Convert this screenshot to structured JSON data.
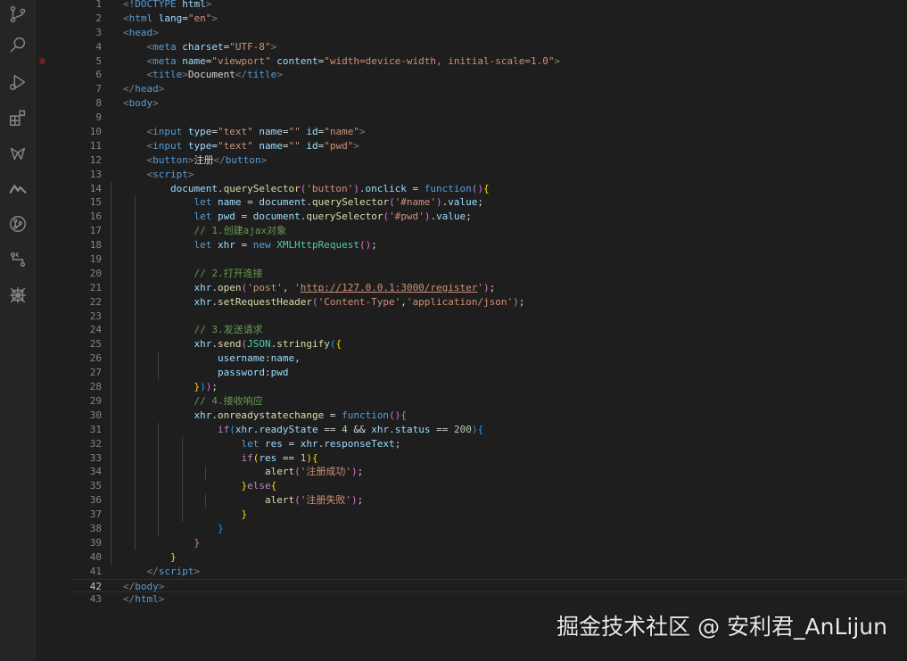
{
  "activity_bar": {
    "icons": [
      "source-control-icon",
      "search-icon",
      "run-debug-icon",
      "extensions-icon",
      "live-share-icon",
      "remote-icon",
      "git-graph-icon",
      "timeline-icon",
      "bug-pattern-icon"
    ]
  },
  "watermark": "掘金技术社区 @ 安利君_AnLijun",
  "editor": {
    "active_line": 42,
    "breakpoint_line": 5,
    "lines": [
      [
        [
          "t-punct",
          "<"
        ],
        [
          "t-tag",
          "!DOCTYPE"
        ],
        [
          "t-text",
          " "
        ],
        [
          "t-attr",
          "html"
        ],
        [
          "t-punct",
          ">"
        ]
      ],
      [
        [
          "t-punct",
          "<"
        ],
        [
          "t-tag",
          "html"
        ],
        [
          "t-text",
          " "
        ],
        [
          "t-attr",
          "lang"
        ],
        [
          "t-text",
          "="
        ],
        [
          "t-str",
          "\"en\""
        ],
        [
          "t-punct",
          ">"
        ]
      ],
      [
        [
          "t-punct",
          "<"
        ],
        [
          "t-tag",
          "head"
        ],
        [
          "t-punct",
          ">"
        ]
      ],
      [
        [
          "t-text",
          "    "
        ],
        [
          "t-punct",
          "<"
        ],
        [
          "t-tag",
          "meta"
        ],
        [
          "t-text",
          " "
        ],
        [
          "t-attr",
          "charset"
        ],
        [
          "t-text",
          "="
        ],
        [
          "t-str",
          "\"UTF-8\""
        ],
        [
          "t-punct",
          ">"
        ]
      ],
      [
        [
          "t-text",
          "    "
        ],
        [
          "t-punct",
          "<"
        ],
        [
          "t-tag",
          "meta"
        ],
        [
          "t-text",
          " "
        ],
        [
          "t-attr",
          "name"
        ],
        [
          "t-text",
          "="
        ],
        [
          "t-str",
          "\"viewport\""
        ],
        [
          "t-text",
          " "
        ],
        [
          "t-attr",
          "content"
        ],
        [
          "t-text",
          "="
        ],
        [
          "t-str",
          "\"width=device-width, initial-scale=1.0\""
        ],
        [
          "t-punct",
          ">"
        ]
      ],
      [
        [
          "t-text",
          "    "
        ],
        [
          "t-punct",
          "<"
        ],
        [
          "t-tag",
          "title"
        ],
        [
          "t-punct",
          ">"
        ],
        [
          "t-text",
          "Document"
        ],
        [
          "t-punct",
          "</"
        ],
        [
          "t-tag",
          "title"
        ],
        [
          "t-punct",
          ">"
        ]
      ],
      [
        [
          "t-punct",
          "</"
        ],
        [
          "t-tag",
          "head"
        ],
        [
          "t-punct",
          ">"
        ]
      ],
      [
        [
          "t-punct",
          "<"
        ],
        [
          "t-tag",
          "body"
        ],
        [
          "t-punct",
          ">"
        ]
      ],
      [],
      [
        [
          "t-text",
          "    "
        ],
        [
          "t-punct",
          "<"
        ],
        [
          "t-tag",
          "input"
        ],
        [
          "t-text",
          " "
        ],
        [
          "t-attr",
          "type"
        ],
        [
          "t-text",
          "="
        ],
        [
          "t-str",
          "\"text\""
        ],
        [
          "t-text",
          " "
        ],
        [
          "t-attr",
          "name"
        ],
        [
          "t-text",
          "="
        ],
        [
          "t-str",
          "\"\""
        ],
        [
          "t-text",
          " "
        ],
        [
          "t-attr",
          "id"
        ],
        [
          "t-text",
          "="
        ],
        [
          "t-str",
          "\"name\""
        ],
        [
          "t-punct",
          ">"
        ]
      ],
      [
        [
          "t-text",
          "    "
        ],
        [
          "t-punct",
          "<"
        ],
        [
          "t-tag",
          "input"
        ],
        [
          "t-text",
          " "
        ],
        [
          "t-attr",
          "type"
        ],
        [
          "t-text",
          "="
        ],
        [
          "t-str",
          "\"text\""
        ],
        [
          "t-text",
          " "
        ],
        [
          "t-attr",
          "name"
        ],
        [
          "t-text",
          "="
        ],
        [
          "t-str",
          "\"\""
        ],
        [
          "t-text",
          " "
        ],
        [
          "t-attr",
          "id"
        ],
        [
          "t-text",
          "="
        ],
        [
          "t-str",
          "\"pwd\""
        ],
        [
          "t-punct",
          ">"
        ]
      ],
      [
        [
          "t-text",
          "    "
        ],
        [
          "t-punct",
          "<"
        ],
        [
          "t-tag",
          "button"
        ],
        [
          "t-punct",
          ">"
        ],
        [
          "t-text",
          "注册"
        ],
        [
          "t-punct",
          "</"
        ],
        [
          "t-tag",
          "button"
        ],
        [
          "t-punct",
          ">"
        ]
      ],
      [
        [
          "t-text",
          "    "
        ],
        [
          "t-punct",
          "<"
        ],
        [
          "t-tag",
          "script"
        ],
        [
          "t-punct",
          ">"
        ]
      ],
      [
        [
          "t-text",
          "        "
        ],
        [
          "t-var",
          "document"
        ],
        [
          "t-text",
          "."
        ],
        [
          "t-fn",
          "querySelector"
        ],
        [
          "t-b2",
          "("
        ],
        [
          "t-str",
          "'button'"
        ],
        [
          "t-b2",
          ")"
        ],
        [
          "t-text",
          "."
        ],
        [
          "t-var",
          "onclick"
        ],
        [
          "t-text",
          " = "
        ],
        [
          "t-kw",
          "function"
        ],
        [
          "t-b2",
          "()"
        ],
        [
          "t-b1",
          "{"
        ]
      ],
      [
        [
          "t-text",
          "            "
        ],
        [
          "t-kw",
          "let"
        ],
        [
          "t-text",
          " "
        ],
        [
          "t-var",
          "name"
        ],
        [
          "t-text",
          " = "
        ],
        [
          "t-var",
          "document"
        ],
        [
          "t-text",
          "."
        ],
        [
          "t-fn",
          "querySelector"
        ],
        [
          "t-b2",
          "("
        ],
        [
          "t-str",
          "'#name'"
        ],
        [
          "t-b2",
          ")"
        ],
        [
          "t-text",
          "."
        ],
        [
          "t-var",
          "value"
        ],
        [
          "t-text",
          ";"
        ]
      ],
      [
        [
          "t-text",
          "            "
        ],
        [
          "t-kw",
          "let"
        ],
        [
          "t-text",
          " "
        ],
        [
          "t-var",
          "pwd"
        ],
        [
          "t-text",
          " = "
        ],
        [
          "t-var",
          "document"
        ],
        [
          "t-text",
          "."
        ],
        [
          "t-fn",
          "querySelector"
        ],
        [
          "t-b2",
          "("
        ],
        [
          "t-str",
          "'#pwd'"
        ],
        [
          "t-b2",
          ")"
        ],
        [
          "t-text",
          "."
        ],
        [
          "t-var",
          "value"
        ],
        [
          "t-text",
          ";"
        ]
      ],
      [
        [
          "t-text",
          "            "
        ],
        [
          "t-cmt",
          "// 1.创建ajax对象"
        ]
      ],
      [
        [
          "t-text",
          "            "
        ],
        [
          "t-kw",
          "let"
        ],
        [
          "t-text",
          " "
        ],
        [
          "t-var",
          "xhr"
        ],
        [
          "t-text",
          " = "
        ],
        [
          "t-kw",
          "new"
        ],
        [
          "t-text",
          " "
        ],
        [
          "t-cls",
          "XMLHttpRequest"
        ],
        [
          "t-b2",
          "()"
        ],
        [
          "t-text",
          ";"
        ]
      ],
      [],
      [
        [
          "t-text",
          "            "
        ],
        [
          "t-cmt",
          "// 2.打开连接"
        ]
      ],
      [
        [
          "t-text",
          "            "
        ],
        [
          "t-var",
          "xhr"
        ],
        [
          "t-text",
          "."
        ],
        [
          "t-fn",
          "open"
        ],
        [
          "t-b2",
          "("
        ],
        [
          "t-str",
          "'post'"
        ],
        [
          "t-text",
          ", "
        ],
        [
          "t-str",
          "'"
        ],
        [
          "t-url",
          "http://127.0.0.1:3000/register"
        ],
        [
          "t-str",
          "'"
        ],
        [
          "t-b2",
          ")"
        ],
        [
          "t-text",
          ";"
        ]
      ],
      [
        [
          "t-text",
          "            "
        ],
        [
          "t-var",
          "xhr"
        ],
        [
          "t-text",
          "."
        ],
        [
          "t-fn",
          "setRequestHeader"
        ],
        [
          "t-b2",
          "("
        ],
        [
          "t-str",
          "'Content-Type'"
        ],
        [
          "t-text",
          ","
        ],
        [
          "t-str",
          "'application/json'"
        ],
        [
          "t-b2",
          ")"
        ],
        [
          "t-text",
          ";"
        ]
      ],
      [],
      [
        [
          "t-text",
          "            "
        ],
        [
          "t-cmt",
          "// 3.发送请求"
        ]
      ],
      [
        [
          "t-text",
          "            "
        ],
        [
          "t-var",
          "xhr"
        ],
        [
          "t-text",
          "."
        ],
        [
          "t-fn",
          "send"
        ],
        [
          "t-b2",
          "("
        ],
        [
          "t-cls",
          "JSON"
        ],
        [
          "t-text",
          "."
        ],
        [
          "t-fn",
          "stringify"
        ],
        [
          "t-b3",
          "("
        ],
        [
          "t-b1",
          "{"
        ]
      ],
      [
        [
          "t-text",
          "                "
        ],
        [
          "t-var",
          "username"
        ],
        [
          "t-text",
          ":"
        ],
        [
          "t-var",
          "name"
        ],
        [
          "t-text",
          ","
        ]
      ],
      [
        [
          "t-text",
          "                "
        ],
        [
          "t-var",
          "password"
        ],
        [
          "t-text",
          ":"
        ],
        [
          "t-var",
          "pwd"
        ]
      ],
      [
        [
          "t-text",
          "            "
        ],
        [
          "t-b1",
          "}"
        ],
        [
          "t-b3",
          ")"
        ],
        [
          "t-b2",
          ")"
        ],
        [
          "t-text",
          ";"
        ]
      ],
      [
        [
          "t-text",
          "            "
        ],
        [
          "t-cmt",
          "// 4.接收响应"
        ]
      ],
      [
        [
          "t-text",
          "            "
        ],
        [
          "t-var",
          "xhr"
        ],
        [
          "t-text",
          "."
        ],
        [
          "t-fn",
          "onreadystatechange"
        ],
        [
          "t-text",
          " = "
        ],
        [
          "t-kw",
          "function"
        ],
        [
          "t-b2",
          "()"
        ],
        [
          "t-b2",
          "{"
        ]
      ],
      [
        [
          "t-text",
          "                "
        ],
        [
          "t-ctrl",
          "if"
        ],
        [
          "t-b3",
          "("
        ],
        [
          "t-var",
          "xhr"
        ],
        [
          "t-text",
          "."
        ],
        [
          "t-var",
          "readyState"
        ],
        [
          "t-text",
          " == "
        ],
        [
          "t-num",
          "4"
        ],
        [
          "t-text",
          " && "
        ],
        [
          "t-var",
          "xhr"
        ],
        [
          "t-text",
          "."
        ],
        [
          "t-var",
          "status"
        ],
        [
          "t-text",
          " == "
        ],
        [
          "t-num",
          "200"
        ],
        [
          "t-b3",
          ")"
        ],
        [
          "t-b3",
          "{"
        ]
      ],
      [
        [
          "t-text",
          "                    "
        ],
        [
          "t-kw",
          "let"
        ],
        [
          "t-text",
          " "
        ],
        [
          "t-var",
          "res"
        ],
        [
          "t-text",
          " = "
        ],
        [
          "t-var",
          "xhr"
        ],
        [
          "t-text",
          "."
        ],
        [
          "t-var",
          "responseText"
        ],
        [
          "t-text",
          ";"
        ]
      ],
      [
        [
          "t-text",
          "                    "
        ],
        [
          "t-ctrl",
          "if"
        ],
        [
          "t-b1",
          "("
        ],
        [
          "t-var",
          "res"
        ],
        [
          "t-text",
          " == "
        ],
        [
          "t-num",
          "1"
        ],
        [
          "t-b1",
          ")"
        ],
        [
          "t-b1",
          "{"
        ]
      ],
      [
        [
          "t-text",
          "                        "
        ],
        [
          "t-fn",
          "alert"
        ],
        [
          "t-b2",
          "("
        ],
        [
          "t-str",
          "'注册成功'"
        ],
        [
          "t-b2",
          ")"
        ],
        [
          "t-text",
          ";"
        ]
      ],
      [
        [
          "t-text",
          "                    "
        ],
        [
          "t-b1",
          "}"
        ],
        [
          "t-ctrl",
          "else"
        ],
        [
          "t-b1",
          "{"
        ]
      ],
      [
        [
          "t-text",
          "                        "
        ],
        [
          "t-fn",
          "alert"
        ],
        [
          "t-b2",
          "("
        ],
        [
          "t-str",
          "'注册失败'"
        ],
        [
          "t-b2",
          ")"
        ],
        [
          "t-text",
          ";"
        ]
      ],
      [
        [
          "t-text",
          "                    "
        ],
        [
          "t-b1",
          "}"
        ]
      ],
      [
        [
          "t-text",
          "                "
        ],
        [
          "t-b3",
          "}"
        ]
      ],
      [
        [
          "t-text",
          "            "
        ],
        [
          "t-b2",
          "}"
        ]
      ],
      [
        [
          "t-text",
          "        "
        ],
        [
          "t-b1",
          "}"
        ]
      ],
      [
        [
          "t-text",
          "    "
        ],
        [
          "t-punct",
          "</"
        ],
        [
          "t-tag",
          "script"
        ],
        [
          "t-punct",
          ">"
        ]
      ],
      [
        [
          "t-punct",
          "</"
        ],
        [
          "t-tag",
          "body"
        ],
        [
          "t-punct",
          ">"
        ]
      ],
      [
        [
          "t-punct",
          "</"
        ],
        [
          "t-tag",
          "html"
        ],
        [
          "t-punct",
          ">"
        ]
      ]
    ]
  }
}
